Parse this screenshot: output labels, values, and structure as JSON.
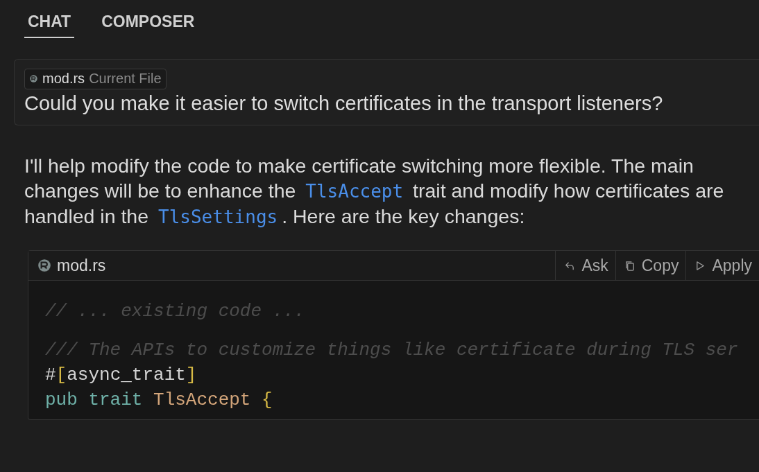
{
  "tabs": [
    {
      "label": "CHAT",
      "selected": true
    },
    {
      "label": "COMPOSER",
      "selected": false
    }
  ],
  "query": {
    "context_chip": {
      "file": "mod.rs",
      "note": "Current File"
    },
    "text": "Could you make it easier to switch certificates in the transport listeners?"
  },
  "response": {
    "paragraph": [
      {
        "kind": "text",
        "text": "I'll help modify the code to make certificate switching more flexible. The main changes will be to enhance the "
      },
      {
        "kind": "code",
        "text": "TlsAccept"
      },
      {
        "kind": "text",
        "text": " trait and modify how certificates are handled in the "
      },
      {
        "kind": "code",
        "text": "TlsSettings"
      },
      {
        "kind": "text",
        "text": ". Here are the key changes:"
      }
    ]
  },
  "code_block": {
    "filename": "mod.rs",
    "actions": [
      {
        "kind": "ask",
        "label": "Ask"
      },
      {
        "kind": "copy",
        "label": "Copy"
      },
      {
        "kind": "apply",
        "label": "Apply"
      }
    ],
    "lines": [
      {
        "kind": "code",
        "tokens": [
          {
            "kind": "comment",
            "text": "// ... existing code ..."
          }
        ]
      },
      {
        "kind": "blank"
      },
      {
        "kind": "code",
        "tokens": [
          {
            "kind": "comment",
            "text": "/// The APIs to customize things like certificate during TLS ser"
          }
        ]
      },
      {
        "kind": "code",
        "tokens": [
          {
            "kind": "plain",
            "text": "#"
          },
          {
            "kind": "bracket",
            "text": "["
          },
          {
            "kind": "plain",
            "text": "async_trait"
          },
          {
            "kind": "bracket",
            "text": "]"
          }
        ]
      },
      {
        "kind": "code",
        "tokens": [
          {
            "kind": "keyword",
            "text": "pub trait "
          },
          {
            "kind": "type",
            "text": "TlsAccept "
          },
          {
            "kind": "bracket",
            "text": "{"
          }
        ]
      }
    ]
  }
}
